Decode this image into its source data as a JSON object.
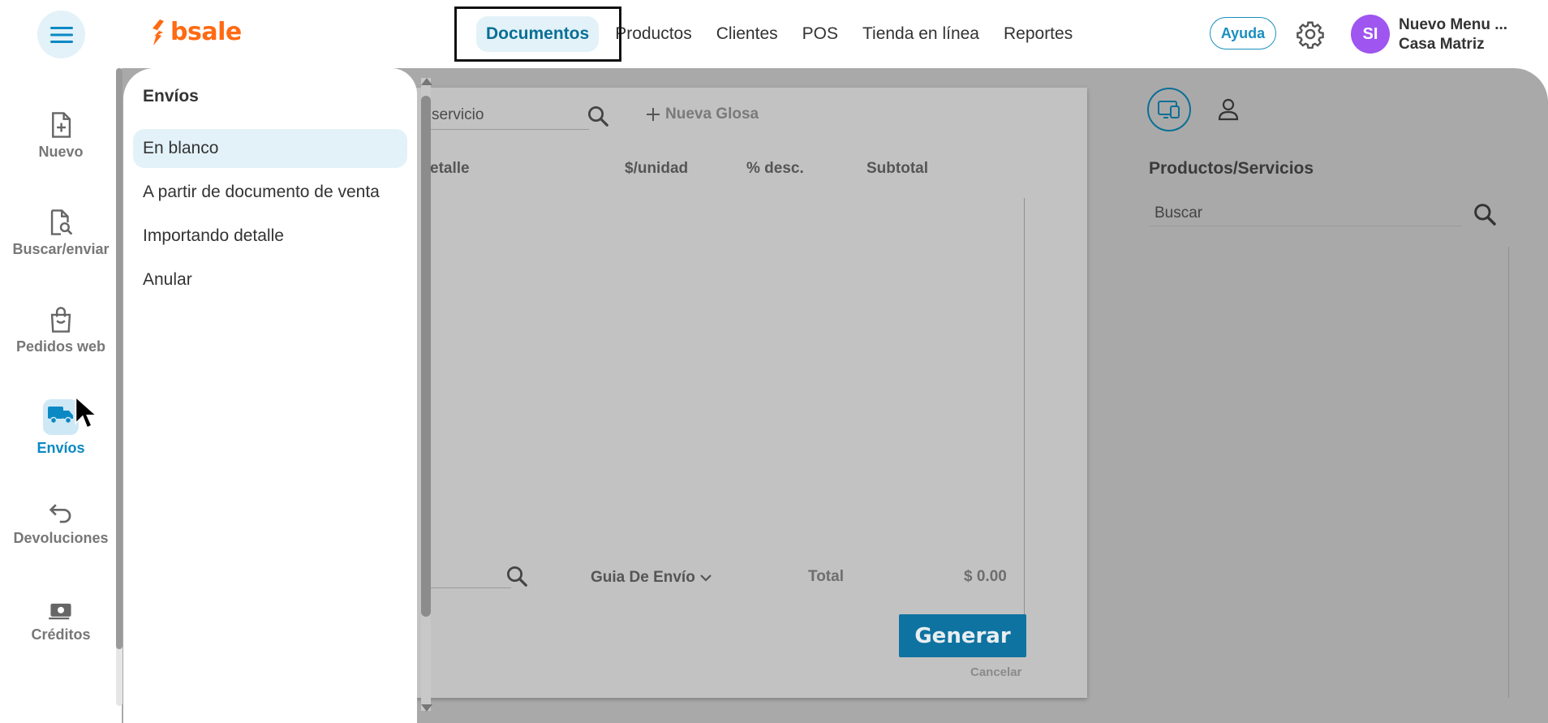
{
  "header": {
    "brand": "bsale",
    "nav": [
      {
        "label": "Documentos",
        "active": true
      },
      {
        "label": "Productos"
      },
      {
        "label": "Clientes"
      },
      {
        "label": "POS"
      },
      {
        "label": "Tienda en línea"
      },
      {
        "label": "Reportes"
      }
    ],
    "help_label": "Ayuda",
    "avatar_initials": "SI",
    "user_name": "Nuevo Menu ...",
    "branch": "Casa Matriz"
  },
  "sidebar": {
    "items": [
      {
        "label": "Nuevo",
        "icon": "file-plus-icon"
      },
      {
        "label": "Buscar/enviar",
        "icon": "file-search-icon"
      },
      {
        "label": "Pedidos web",
        "icon": "shopping-bag-icon"
      },
      {
        "label": "Envíos",
        "icon": "truck-icon",
        "active": true
      },
      {
        "label": "Devoluciones",
        "icon": "return-arrow-icon"
      },
      {
        "label": "Créditos",
        "icon": "money-icon"
      }
    ]
  },
  "submenu": {
    "title": "Envíos",
    "items": [
      {
        "label": "En blanco",
        "selected": true
      },
      {
        "label": "A partir de documento de venta"
      },
      {
        "label": "Importando detalle"
      },
      {
        "label": "Anular"
      }
    ]
  },
  "document": {
    "search_placeholder": "servicio",
    "new_glosa_label": "Nueva Glosa",
    "columns": [
      "etalle",
      "$/unidad",
      "% desc.",
      "Subtotal"
    ],
    "document_type": "Guia De Envío",
    "total_label": "Total",
    "total_value": "$ 0.00",
    "generate_label": "Generar",
    "cancel_label": "Cancelar"
  },
  "right_panel": {
    "title": "Productos/Servicios",
    "search_placeholder": "Buscar"
  },
  "colors": {
    "brand_orange": "#ff6a13",
    "accent_blue": "#0a89c4",
    "avatar_purple": "#9f55f0",
    "active_bg": "#e3f2f8"
  }
}
